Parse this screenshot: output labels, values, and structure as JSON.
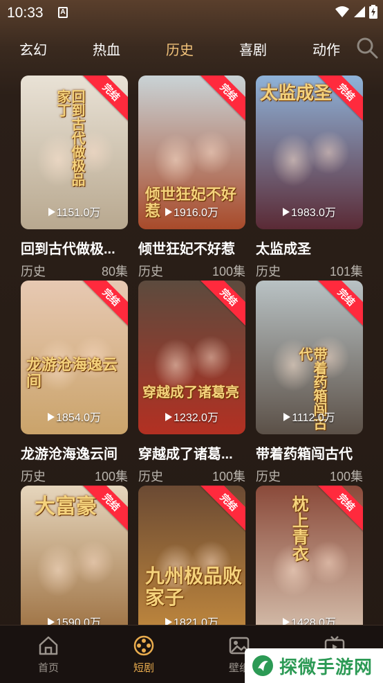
{
  "status": {
    "time": "10:33",
    "notification_glyph": "A"
  },
  "tabs": [
    {
      "label": "玄幻"
    },
    {
      "label": "热血"
    },
    {
      "label": "历史"
    },
    {
      "label": "喜剧"
    },
    {
      "label": "动作"
    }
  ],
  "active_tab": "历史",
  "ribbon_label": "完结",
  "cards": [
    {
      "title": "回到古代做极...",
      "art_title": "回到古代做极品家丁",
      "views": "1151.0万",
      "genre": "历史",
      "episodes": "80集",
      "colors": [
        "#e9e2d6",
        "#b8a88f"
      ]
    },
    {
      "title": "倾世狂妃不好惹",
      "art_title": "倾世狂妃不好惹",
      "views": "1916.0万",
      "genre": "历史",
      "episodes": "100集",
      "colors": [
        "#c9d3d6",
        "#a84a2a"
      ]
    },
    {
      "title": "太监成圣",
      "art_title": "太监成圣",
      "views": "1983.0万",
      "genre": "历史",
      "episodes": "101集",
      "colors": [
        "#8fb3d9",
        "#5a2a35"
      ]
    },
    {
      "title": "龙游沧海逸云间",
      "art_title": "龙游沧海逸云间",
      "views": "1854.0万",
      "genre": "历史",
      "episodes": "100集",
      "colors": [
        "#e7c9b3",
        "#caa36a"
      ]
    },
    {
      "title": "穿越成了诸葛...",
      "art_title": "穿越成了诸葛亮",
      "views": "1232.0万",
      "genre": "历史",
      "episodes": "100集",
      "colors": [
        "#5c4b3e",
        "#b33022"
      ]
    },
    {
      "title": "带着药箱闯古代",
      "art_title": "带着药箱闯古代",
      "views": "1112.0万",
      "genre": "历史",
      "episodes": "100集",
      "colors": [
        "#b9c2c4",
        "#5b5047"
      ]
    },
    {
      "title": "",
      "art_title": "大富豪",
      "views": "1590.0万",
      "genre": "",
      "episodes": "",
      "colors": [
        "#e6d6bd",
        "#9a6d3d"
      ]
    },
    {
      "title": "",
      "art_title": "九州极品败家子",
      "views": "1821.0万",
      "genre": "",
      "episodes": "",
      "colors": [
        "#6b4a33",
        "#c38a3e"
      ]
    },
    {
      "title": "",
      "art_title": "枕上青衣",
      "views": "1428.0万",
      "genre": "",
      "episodes": "",
      "colors": [
        "#8a4a3a",
        "#d8c3b0"
      ]
    }
  ],
  "nav": [
    {
      "label": "首页",
      "icon": "home-icon"
    },
    {
      "label": "短剧",
      "icon": "film-reel-icon"
    },
    {
      "label": "壁纸",
      "icon": "image-icon"
    },
    {
      "label": "",
      "icon": "tv-icon"
    }
  ],
  "watermark": {
    "text": "探微手游网"
  },
  "colors": {
    "accent": "#f1c27a",
    "nav_active": "#e9ac4e",
    "ribbon": "#ff2a3d"
  }
}
